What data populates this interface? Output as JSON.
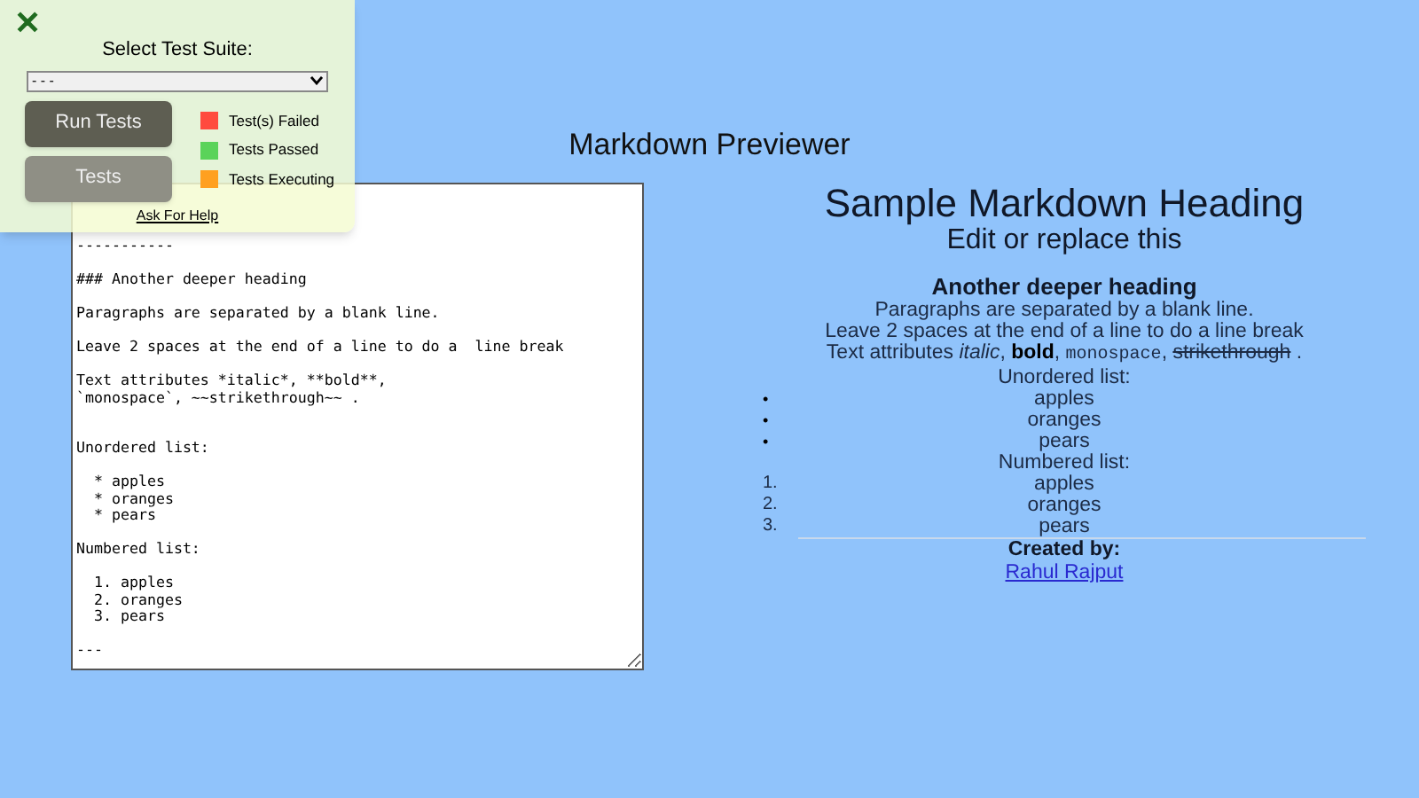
{
  "test_panel": {
    "close": "✕",
    "suite_label": "Select Test Suite:",
    "suite_value": "- - -",
    "buttons": [
      {
        "label": "Run Tests",
        "kind": "primary"
      },
      {
        "label": "Tests",
        "kind": "secondary"
      }
    ],
    "legend": [
      {
        "label": "Test(s) Failed",
        "color": "#ff4b3e"
      },
      {
        "label": "Tests Passed",
        "color": "#5ad35a"
      },
      {
        "label": "Tests Executing",
        "color": "#ffa020"
      }
    ],
    "help_link": "Ask For Help"
  },
  "title": "Markdown Previewer",
  "editor": {
    "value": "-----------\n\n### Another deeper heading\n\nParagraphs are separated by a blank line.\n\nLeave 2 spaces at the end of a line to do a  line break\n\nText attributes *italic*, **bold**,\n`monospace`, ~~strikethrough~~ .\n\n\nUnordered list:\n\n  * apples\n  * oranges\n  * pears\n\nNumbered list:\n\n  1. apples\n  2. oranges\n  3. pears\n\n---"
  },
  "preview": {
    "h1": "Sample Markdown Heading",
    "h2": "Edit or replace this",
    "h3": "Another deeper heading",
    "paragraphs": [
      "Paragraphs are separated by a blank line.",
      "Leave 2 spaces at the end of a line to do a line break"
    ],
    "attributes": [
      {
        "kind": "plain",
        "text": "Text attributes "
      },
      {
        "kind": "italic",
        "text": "italic"
      },
      {
        "kind": "plain",
        "text": ", "
      },
      {
        "kind": "bold",
        "text": "bold"
      },
      {
        "kind": "plain",
        "text": ", "
      },
      {
        "kind": "code",
        "text": "monospace"
      },
      {
        "kind": "plain",
        "text": ", "
      },
      {
        "kind": "strike",
        "text": "strikethrough"
      },
      {
        "kind": "plain",
        "text": " ."
      }
    ],
    "unordered_label": "Unordered list:",
    "unordered": [
      {
        "marker": "•",
        "text": "apples"
      },
      {
        "marker": "•",
        "text": "oranges"
      },
      {
        "marker": "•",
        "text": "pears"
      }
    ],
    "numbered_label": "Numbered list:",
    "numbered": [
      {
        "marker": "1.",
        "text": "apples"
      },
      {
        "marker": "2.",
        "text": "oranges"
      },
      {
        "marker": "3.",
        "text": "pears"
      }
    ],
    "created_by": "Created by:",
    "author_link": "Rahul Rajput"
  }
}
